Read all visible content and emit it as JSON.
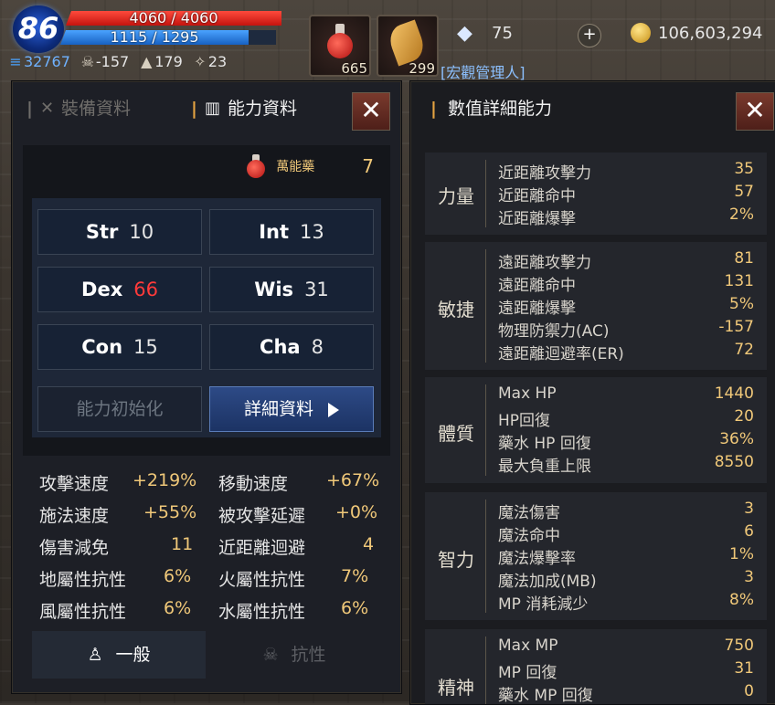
{
  "hud": {
    "level": "86",
    "hp_text": "4060 / 4060",
    "mp_text": "1115 / 1295",
    "stats": [
      {
        "icon": "lawful-icon",
        "value": "32767"
      },
      {
        "icon": "skull-icon",
        "value": "-157"
      },
      {
        "icon": "hat-icon",
        "value": "179"
      },
      {
        "icon": "wing-icon",
        "value": "23"
      }
    ],
    "slot1_count": "665",
    "slot2_count": "299",
    "gem_value": "75",
    "gold_value": "106,603,294",
    "name_tag": "[宏觀管理人]"
  },
  "left_panel": {
    "tab_equipment": "裝備資料",
    "tab_ability": "能力資料",
    "close_symbol": "✕",
    "potion_label": "萬能藥",
    "potion_count": "7",
    "stats": {
      "str_label": "Str",
      "str_value": "10",
      "int_label": "Int",
      "int_value": "13",
      "dex_label": "Dex",
      "dex_value": "66",
      "wis_label": "Wis",
      "wis_value": "31",
      "con_label": "Con",
      "con_value": "15",
      "cha_label": "Cha",
      "cha_value": "8"
    },
    "reset_button": "能力初始化",
    "detail_button": "詳細資料",
    "summary": [
      {
        "l1": "攻擊速度",
        "v1": "+219%",
        "l2": "移動速度",
        "v2": "+67%"
      },
      {
        "l1": "施法速度",
        "v1": "+55%",
        "l2": "被攻擊延遲",
        "v2": "+0%"
      },
      {
        "l1": "傷害減免",
        "v1": "11",
        "l2": "近距離迴避",
        "v2": "4"
      },
      {
        "l1": "地屬性抗性",
        "v1": "6%",
        "l2": "火屬性抗性",
        "v2": "7%"
      },
      {
        "l1": "風屬性抗性",
        "v1": "6%",
        "l2": "水屬性抗性",
        "v2": "6%"
      }
    ],
    "tab_general": "一般",
    "tab_resist": "抗性"
  },
  "right_panel": {
    "title": "數值詳細能力",
    "close_symbol": "✕",
    "groups": [
      {
        "name": "力量",
        "rows": [
          {
            "label": "近距離攻擊力",
            "value": "35"
          },
          {
            "label": "近距離命中",
            "value": "57"
          },
          {
            "label": "近距離爆擊",
            "value": "2%"
          }
        ]
      },
      {
        "name": "敏捷",
        "rows": [
          {
            "label": "遠距離攻擊力",
            "value": "81"
          },
          {
            "label": "遠距離命中",
            "value": "131"
          },
          {
            "label": "遠距離爆擊",
            "value": "5%"
          },
          {
            "label": "物理防禦力(AC)",
            "value": "-157"
          },
          {
            "label": "遠距離迴避率(ER)",
            "value": "72"
          }
        ]
      },
      {
        "name": "體質",
        "rows": [
          {
            "label": "Max HP",
            "value": "1440"
          },
          {
            "label": "HP回復",
            "value": "20"
          },
          {
            "label": "藥水 HP 回復",
            "value": "36%"
          },
          {
            "label": "最大負重上限",
            "value": "8550"
          }
        ]
      },
      {
        "name": "智力",
        "rows": [
          {
            "label": "魔法傷害",
            "value": "3"
          },
          {
            "label": "魔法命中",
            "value": "6"
          },
          {
            "label": "魔法爆擊率",
            "value": "1%"
          },
          {
            "label": "魔法加成(MB)",
            "value": "3"
          },
          {
            "label": "MP 消耗減少",
            "value": "8%"
          }
        ]
      },
      {
        "name": "精神",
        "rows": [
          {
            "label": "Max MP",
            "value": "750"
          },
          {
            "label": "MP 回復",
            "value": "31"
          },
          {
            "label": "藥水 MP 回復",
            "value": "0"
          }
        ]
      }
    ]
  },
  "colors": {
    "accent": "#e5a341",
    "value_gold": "#f0c879",
    "dex_red": "#ff3a3a",
    "button_blue": "#2d4a86"
  }
}
